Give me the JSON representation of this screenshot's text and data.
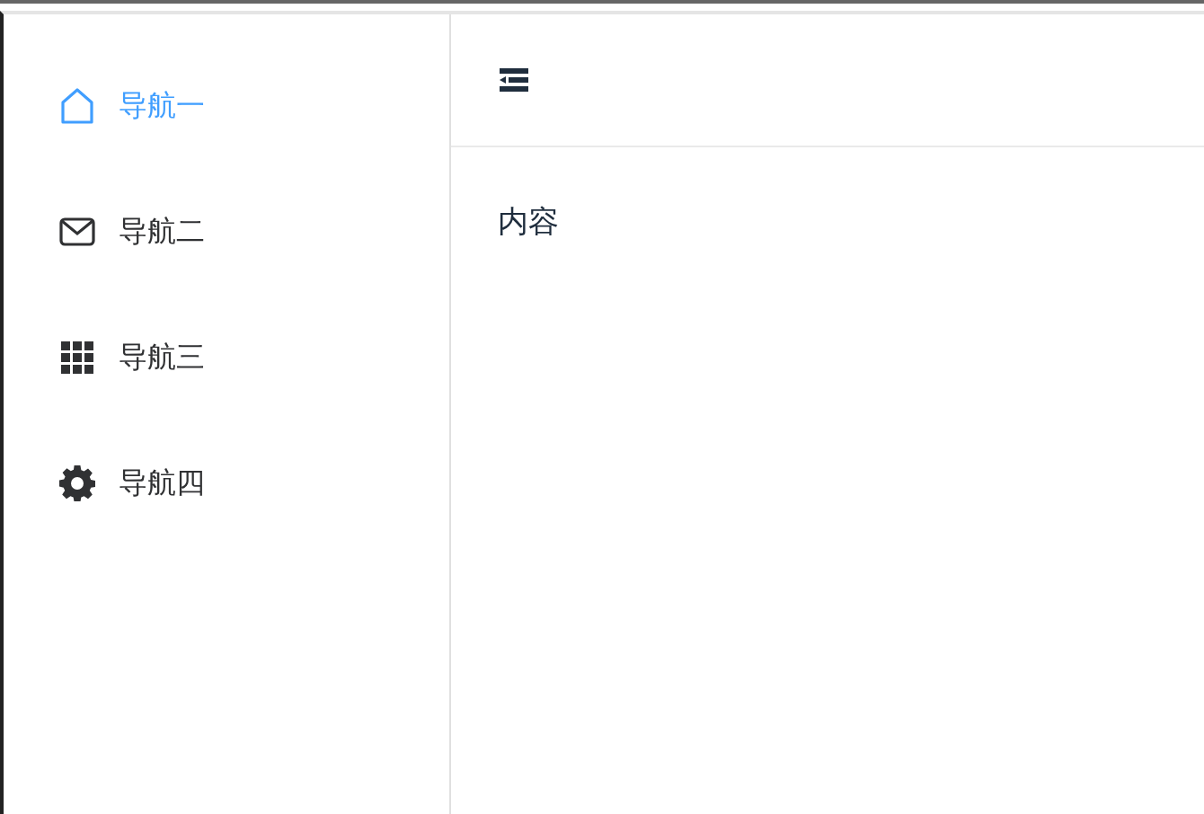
{
  "sidebar": {
    "items": [
      {
        "label": "导航一",
        "selected": true
      },
      {
        "label": "导航二",
        "selected": false
      },
      {
        "label": "导航三",
        "selected": false
      },
      {
        "label": "导航四",
        "selected": false
      }
    ]
  },
  "content": {
    "text": "内容"
  }
}
